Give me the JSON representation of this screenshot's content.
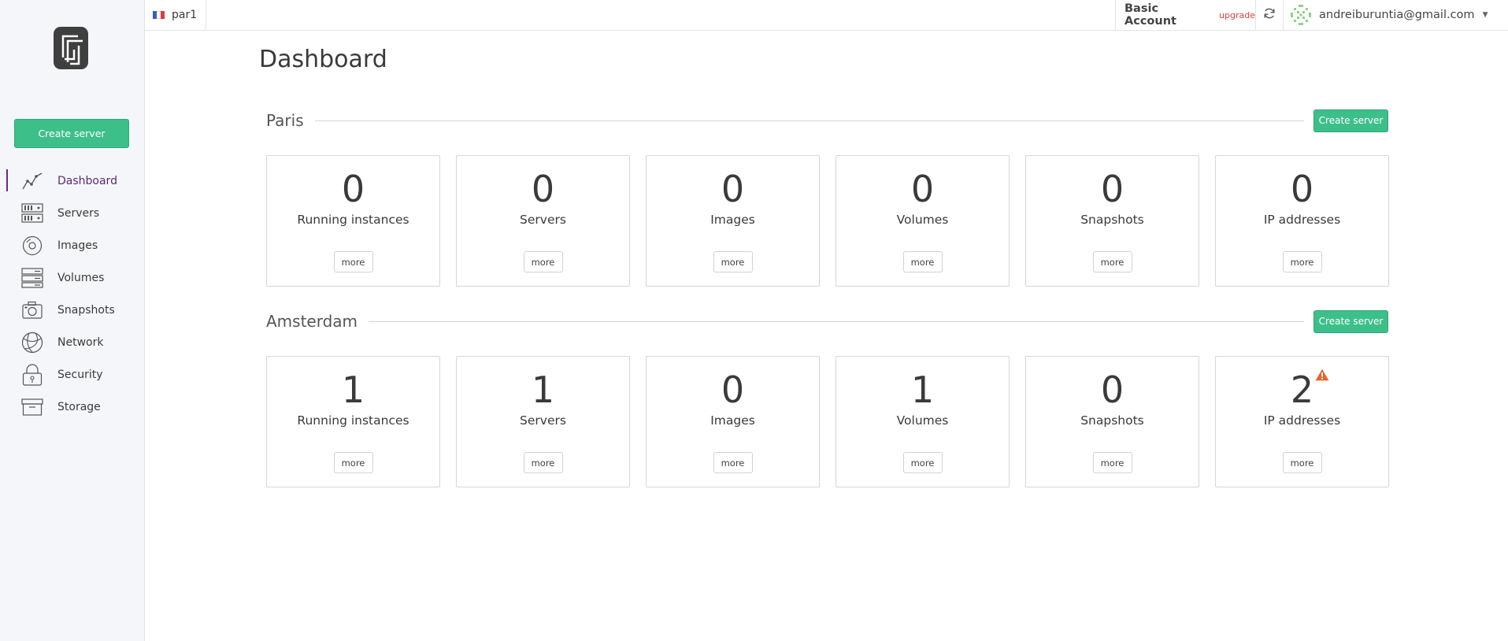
{
  "sidebar": {
    "create_label": "Create server",
    "items": [
      {
        "label": "Dashboard",
        "icon": "dashboard-chart-icon",
        "active": true
      },
      {
        "label": "Servers",
        "icon": "servers-icon"
      },
      {
        "label": "Images",
        "icon": "images-disc-icon"
      },
      {
        "label": "Volumes",
        "icon": "volumes-icon"
      },
      {
        "label": "Snapshots",
        "icon": "camera-icon"
      },
      {
        "label": "Network",
        "icon": "globe-icon"
      },
      {
        "label": "Security",
        "icon": "lock-icon"
      },
      {
        "label": "Storage",
        "icon": "storage-box-icon"
      }
    ]
  },
  "topbar": {
    "region": "par1",
    "flag_colors": [
      "#3b5bbd",
      "#ffffff",
      "#e03c3c"
    ],
    "account": "Basic Account",
    "upgrade": "upgrade",
    "email": "andreiburuntia@gmail.com"
  },
  "main": {
    "title": "Dashboard",
    "sections": [
      {
        "name": "Paris",
        "button": "Create server",
        "cards": [
          {
            "count": "0",
            "label": "Running instances",
            "more": "more"
          },
          {
            "count": "0",
            "label": "Servers",
            "more": "more"
          },
          {
            "count": "0",
            "label": "Images",
            "more": "more"
          },
          {
            "count": "0",
            "label": "Volumes",
            "more": "more"
          },
          {
            "count": "0",
            "label": "Snapshots",
            "more": "more"
          },
          {
            "count": "0",
            "label": "IP addresses",
            "more": "more"
          }
        ]
      },
      {
        "name": "Amsterdam",
        "button": "Create server",
        "cards": [
          {
            "count": "1",
            "label": "Running instances",
            "more": "more"
          },
          {
            "count": "1",
            "label": "Servers",
            "more": "more"
          },
          {
            "count": "0",
            "label": "Images",
            "more": "more"
          },
          {
            "count": "1",
            "label": "Volumes",
            "more": "more"
          },
          {
            "count": "0",
            "label": "Snapshots",
            "more": "more"
          },
          {
            "count": "2",
            "label": "IP addresses",
            "more": "more",
            "warning": true
          }
        ]
      }
    ]
  },
  "colors": {
    "accent_green": "#3dbf8a",
    "active_purple": "#6a2c7a",
    "warning_orange": "#e8622c",
    "upgrade_red": "#d9413b"
  }
}
